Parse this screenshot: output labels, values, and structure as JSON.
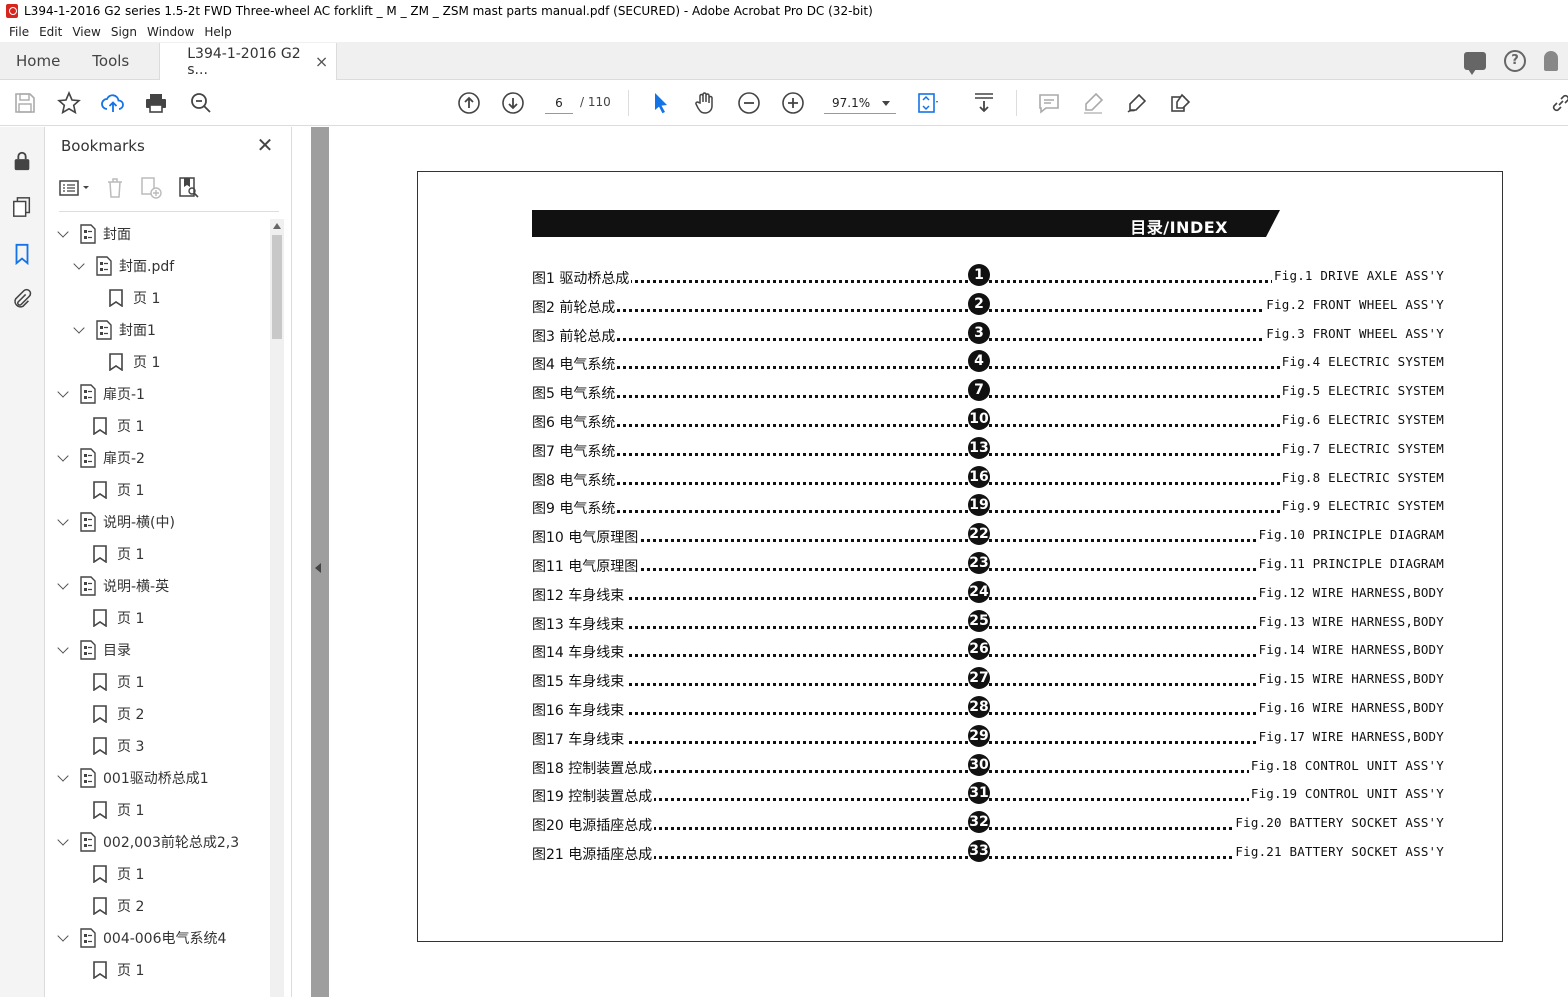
{
  "window": {
    "title": "L394-1-2016 G2 series 1.5-2t FWD Three-wheel AC forklift _ M _ ZM _ ZSM mast parts manual.pdf (SECURED) - Adobe Acrobat Pro DC (32-bit)"
  },
  "menu": [
    "File",
    "Edit",
    "View",
    "Sign",
    "Window",
    "Help"
  ],
  "tabs": {
    "home": "Home",
    "tools": "Tools",
    "document": "L394-1-2016 G2 s...",
    "close": "×"
  },
  "toolbar": {
    "current_page": "6",
    "total_pages": "/ 110",
    "zoom": "97.1%"
  },
  "bookmarks": {
    "title": "Bookmarks",
    "close": "✕",
    "items": [
      {
        "label": "封面",
        "type": "node",
        "level": 0
      },
      {
        "label": "封面.pdf",
        "type": "node",
        "level": 1
      },
      {
        "label": "页 1",
        "type": "page",
        "level": 2
      },
      {
        "label": "封面1",
        "type": "node",
        "level": 1
      },
      {
        "label": "页 1",
        "type": "page",
        "level": 2
      },
      {
        "label": "扉页-1",
        "type": "node",
        "level": 0
      },
      {
        "label": "页 1",
        "type": "page",
        "level": 1
      },
      {
        "label": "扉页-2",
        "type": "node",
        "level": 0
      },
      {
        "label": "页 1",
        "type": "page",
        "level": 1
      },
      {
        "label": "说明-横(中)",
        "type": "node",
        "level": 0
      },
      {
        "label": "页 1",
        "type": "page",
        "level": 1
      },
      {
        "label": "说明-横-英",
        "type": "node",
        "level": 0
      },
      {
        "label": "页 1",
        "type": "page",
        "level": 1
      },
      {
        "label": "目录",
        "type": "node",
        "level": 0
      },
      {
        "label": "页 1",
        "type": "page",
        "level": 1
      },
      {
        "label": "页 2",
        "type": "page",
        "level": 1
      },
      {
        "label": "页 3",
        "type": "page",
        "level": 1
      },
      {
        "label": "001驱动桥总成1",
        "type": "node",
        "level": 0
      },
      {
        "label": "页 1",
        "type": "page",
        "level": 1
      },
      {
        "label": "002,003前轮总成2,3",
        "type": "node",
        "level": 0
      },
      {
        "label": "页 1",
        "type": "page",
        "level": 1
      },
      {
        "label": "页 2",
        "type": "page",
        "level": 1
      },
      {
        "label": "004-006电气系统4",
        "type": "node",
        "level": 0
      },
      {
        "label": "页 1",
        "type": "page",
        "level": 1
      }
    ]
  },
  "document": {
    "banner": "目录/INDEX",
    "entries": [
      {
        "cn": "图1 驱动桥总成",
        "page": "1",
        "en": "Fig.1 DRIVE AXLE ASS'Y"
      },
      {
        "cn": "图2 前轮总成",
        "page": "2",
        "en": "Fig.2 FRONT WHEEL ASS'Y"
      },
      {
        "cn": "图3 前轮总成",
        "page": "3",
        "en": "Fig.3 FRONT WHEEL ASS'Y"
      },
      {
        "cn": "图4 电气系统",
        "page": "4",
        "en": "Fig.4 ELECTRIC SYSTEM"
      },
      {
        "cn": "图5 电气系统",
        "page": "7",
        "en": "Fig.5 ELECTRIC SYSTEM"
      },
      {
        "cn": "图6 电气系统",
        "page": "10",
        "en": "Fig.6 ELECTRIC SYSTEM"
      },
      {
        "cn": "图7 电气系统",
        "page": "13",
        "en": "Fig.7 ELECTRIC SYSTEM"
      },
      {
        "cn": "图8 电气系统",
        "page": "16",
        "en": "Fig.8 ELECTRIC SYSTEM"
      },
      {
        "cn": "图9 电气系统",
        "page": "19",
        "en": "Fig.9 ELECTRIC SYSTEM"
      },
      {
        "cn": "图10 电气原理图",
        "page": "22",
        "en": "Fig.10 PRINCIPLE DIAGRAM"
      },
      {
        "cn": "图11 电气原理图",
        "page": "23",
        "en": "Fig.11 PRINCIPLE DIAGRAM"
      },
      {
        "cn": "图12 车身线束",
        "page": "24",
        "en": "Fig.12 WIRE HARNESS,BODY"
      },
      {
        "cn": "图13 车身线束",
        "page": "25",
        "en": "Fig.13 WIRE HARNESS,BODY"
      },
      {
        "cn": "图14 车身线束",
        "page": "26",
        "en": "Fig.14 WIRE HARNESS,BODY"
      },
      {
        "cn": "图15 车身线束",
        "page": "27",
        "en": "Fig.15 WIRE HARNESS,BODY"
      },
      {
        "cn": "图16 车身线束",
        "page": "28",
        "en": "Fig.16 WIRE HARNESS,BODY"
      },
      {
        "cn": "图17 车身线束",
        "page": "29",
        "en": "Fig.17 WIRE HARNESS,BODY"
      },
      {
        "cn": "图18 控制装置总成",
        "page": "30",
        "en": "Fig.18 CONTROL UNIT ASS'Y"
      },
      {
        "cn": "图19 控制装置总成",
        "page": "31",
        "en": "Fig.19 CONTROL UNIT ASS'Y"
      },
      {
        "cn": "图20 电源插座总成",
        "page": "32",
        "en": "Fig.20 BATTERY SOCKET ASS'Y"
      },
      {
        "cn": "图21 电源插座总成",
        "page": "33",
        "en": "Fig.21 BATTERY SOCKET ASS'Y"
      }
    ]
  }
}
